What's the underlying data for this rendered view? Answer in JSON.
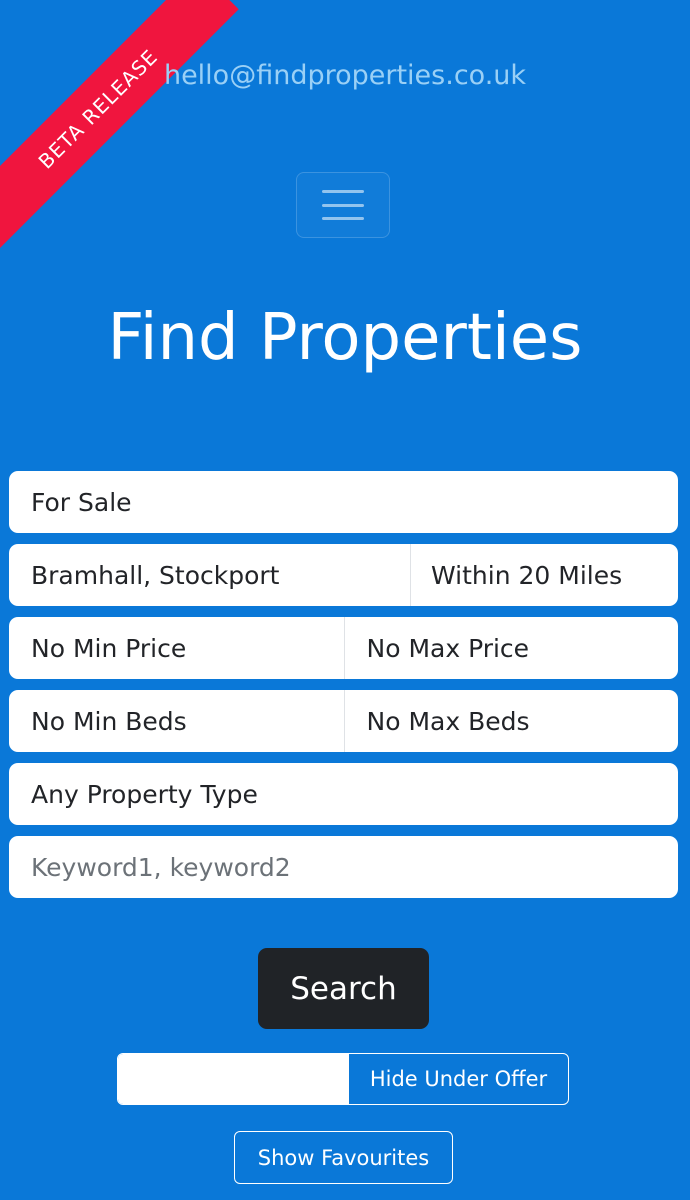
{
  "banner": {
    "ribbon_label": "BETA RELEASE",
    "ribbon_color": "#f0153e"
  },
  "header": {
    "email": "hello@findproperties.co.uk",
    "menu_icon": "hamburger-icon"
  },
  "hero": {
    "title": "Find Properties"
  },
  "search_form": {
    "listing_type": "For Sale",
    "location": "Bramhall, Stockport",
    "radius": "Within 20 Miles",
    "min_price": "No Min Price",
    "max_price": "No Max Price",
    "min_beds": "No Min Beds",
    "max_beds": "No Max Beds",
    "property_type": "Any Property Type",
    "keywords_value": "",
    "keywords_placeholder": "Keyword1, keyword2",
    "search_label": "Search"
  },
  "filters": {
    "hide_under_offer_label": "Hide Under Offer",
    "show_favourites_label": "Show Favourites"
  },
  "theme": {
    "background": "#0a78d8",
    "search_button": "#202327"
  }
}
